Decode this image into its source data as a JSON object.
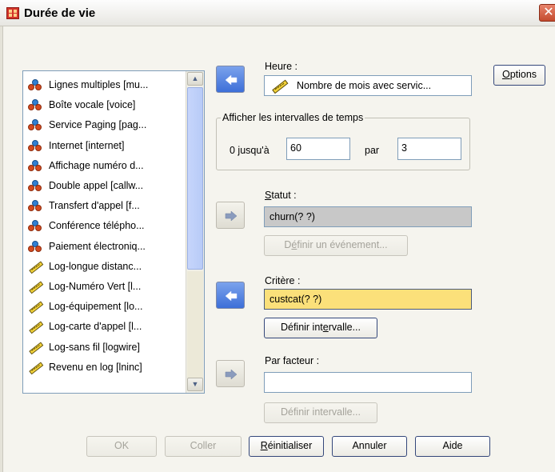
{
  "window": {
    "title": "Durée de vie",
    "close_glyph": "✕"
  },
  "variables": [
    {
      "label": "Lignes multiples [mu...",
      "icon": "nominal-icon"
    },
    {
      "label": "Boîte vocale [voice]",
      "icon": "nominal-icon"
    },
    {
      "label": "Service Paging [pag...",
      "icon": "nominal-icon"
    },
    {
      "label": "Internet [internet]",
      "icon": "nominal-icon"
    },
    {
      "label": "Affichage numéro d...",
      "icon": "nominal-icon"
    },
    {
      "label": "Double appel [callw...",
      "icon": "nominal-icon"
    },
    {
      "label": "Transfert d'appel [f...",
      "icon": "nominal-icon"
    },
    {
      "label": "Conférence télépho...",
      "icon": "nominal-icon"
    },
    {
      "label": "Paiement électroniq...",
      "icon": "nominal-icon"
    },
    {
      "label": "Log-longue distanc...",
      "icon": "scale-icon"
    },
    {
      "label": "Log-Numéro Vert [l...",
      "icon": "scale-icon"
    },
    {
      "label": "Log-équipement [lo...",
      "icon": "scale-icon"
    },
    {
      "label": "Log-carte d'appel [l...",
      "icon": "scale-icon"
    },
    {
      "label": "Log-sans fil [logwire]",
      "icon": "scale-icon"
    },
    {
      "label": "Revenu en log [lninc]",
      "icon": "scale-icon"
    }
  ],
  "heure": {
    "label": "Heure :",
    "value": "Nombre de mois avec servic..."
  },
  "intervals": {
    "group_title": "Afficher les intervalles de temps",
    "from_label": "0 jusqu'à",
    "to_value": "60",
    "by_label": "par",
    "by_value": "3"
  },
  "statut": {
    "label": "Statut :",
    "value": "churn(? ?)",
    "define_event_pre": "D",
    "define_event_u": "é",
    "define_event_post": "finir un événement..."
  },
  "critere": {
    "label": "Critère :",
    "value": "custcat(? ?)",
    "define_range_pre": "Définir int",
    "define_range_u": "e",
    "define_range_post": "rvalle..."
  },
  "facteur": {
    "label": "Par facteur :",
    "value": "",
    "define_range_pre": "Définir intervalle..."
  },
  "options_button": {
    "u": "O",
    "post": "ptions"
  },
  "footer": {
    "ok": "OK",
    "paste": "Coller",
    "reset_u": "R",
    "reset_post": "éinitialiser",
    "cancel": "Annuler",
    "help": "Aide"
  },
  "colors": {
    "accent": "#3d6fd8",
    "criterion_highlight": "#fbe07a",
    "status_field": "#c8c8c8"
  }
}
